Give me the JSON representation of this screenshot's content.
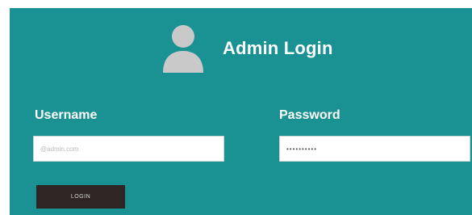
{
  "header": {
    "icon": "user-avatar-icon",
    "title": "Admin Login"
  },
  "form": {
    "username": {
      "label": "Username",
      "placeholder": "@admin.com",
      "value": ""
    },
    "password": {
      "label": "Password",
      "value": "••••••••••"
    },
    "submit_label": "LOGIN"
  },
  "colors": {
    "panel": "#1a9192",
    "button": "#2f2523",
    "avatar": "#c9c9c9"
  }
}
